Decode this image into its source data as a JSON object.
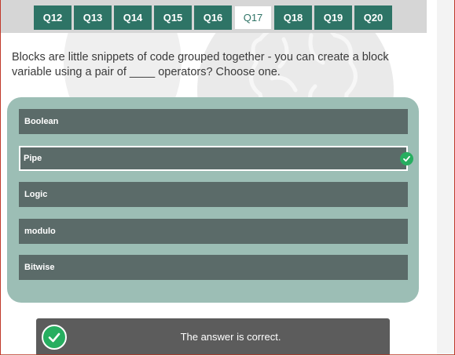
{
  "tabs": [
    {
      "label": "Q12",
      "active": false
    },
    {
      "label": "Q13",
      "active": false
    },
    {
      "label": "Q14",
      "active": false
    },
    {
      "label": "Q15",
      "active": false
    },
    {
      "label": "Q16",
      "active": false
    },
    {
      "label": "Q17",
      "active": true
    },
    {
      "label": "Q18",
      "active": false
    },
    {
      "label": "Q19",
      "active": false
    },
    {
      "label": "Q20",
      "active": false
    }
  ],
  "question": {
    "text": "Blocks are little snippets of code grouped together - you can create a block variable using a pair of ____ operators? Choose one."
  },
  "options": [
    {
      "label": "Boolean",
      "selected": false
    },
    {
      "label": "Pipe",
      "selected": true
    },
    {
      "label": "Logic",
      "selected": false
    },
    {
      "label": "modulo",
      "selected": false
    },
    {
      "label": "Bitwise",
      "selected": false
    }
  ],
  "feedback": {
    "text": "The answer is correct.",
    "icon": "check-circle-icon"
  },
  "colors": {
    "tab": "#2e7466",
    "panel": "#9cbeb5",
    "option": "#5b6b69",
    "success": "#27ae60",
    "feedback_bg": "#5c5c5c"
  }
}
